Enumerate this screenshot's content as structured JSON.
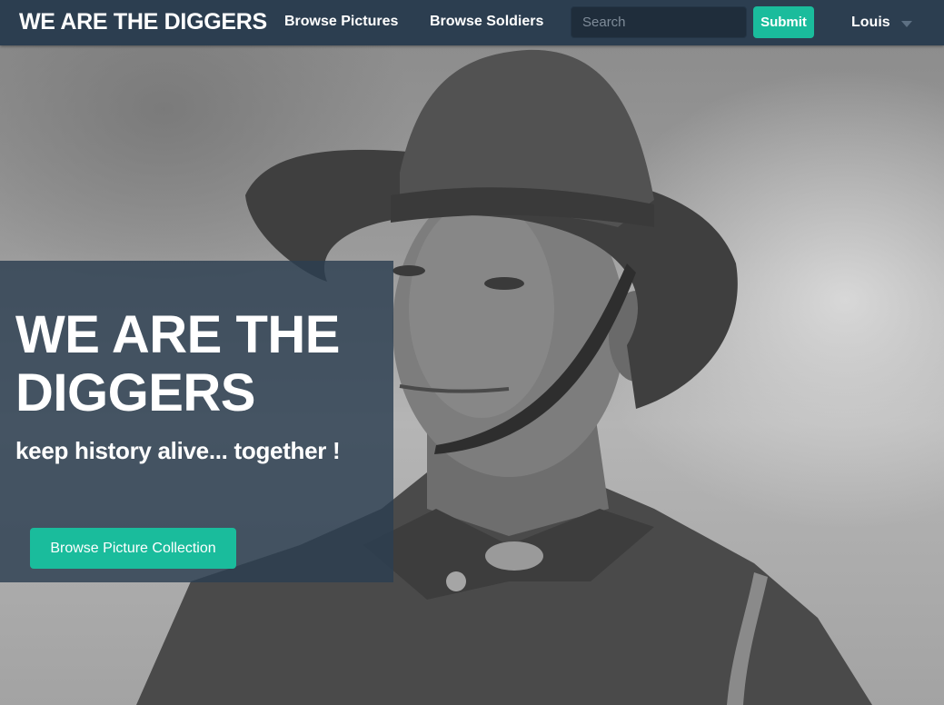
{
  "navbar": {
    "brand": "WE ARE THE DIGGERS",
    "links": [
      {
        "label": "Browse Pictures"
      },
      {
        "label": "Browse Soldiers"
      }
    ],
    "search": {
      "placeholder": "Search",
      "value": ""
    },
    "submit_label": "Submit",
    "user": {
      "name": "Louis",
      "menu_icon": "caret-down-icon"
    }
  },
  "hero": {
    "image": "soldier-portrait-photo",
    "title": "WE ARE THE DIGGERS",
    "subtitle": "keep history alive... together !",
    "cta_label": "Browse Picture Collection"
  },
  "colors": {
    "navbar_bg": "#2c3e50",
    "search_bg": "#1f2d3b",
    "accent": "#1abc9c",
    "panel_bg": "#2c3e50",
    "text": "#ffffff"
  }
}
